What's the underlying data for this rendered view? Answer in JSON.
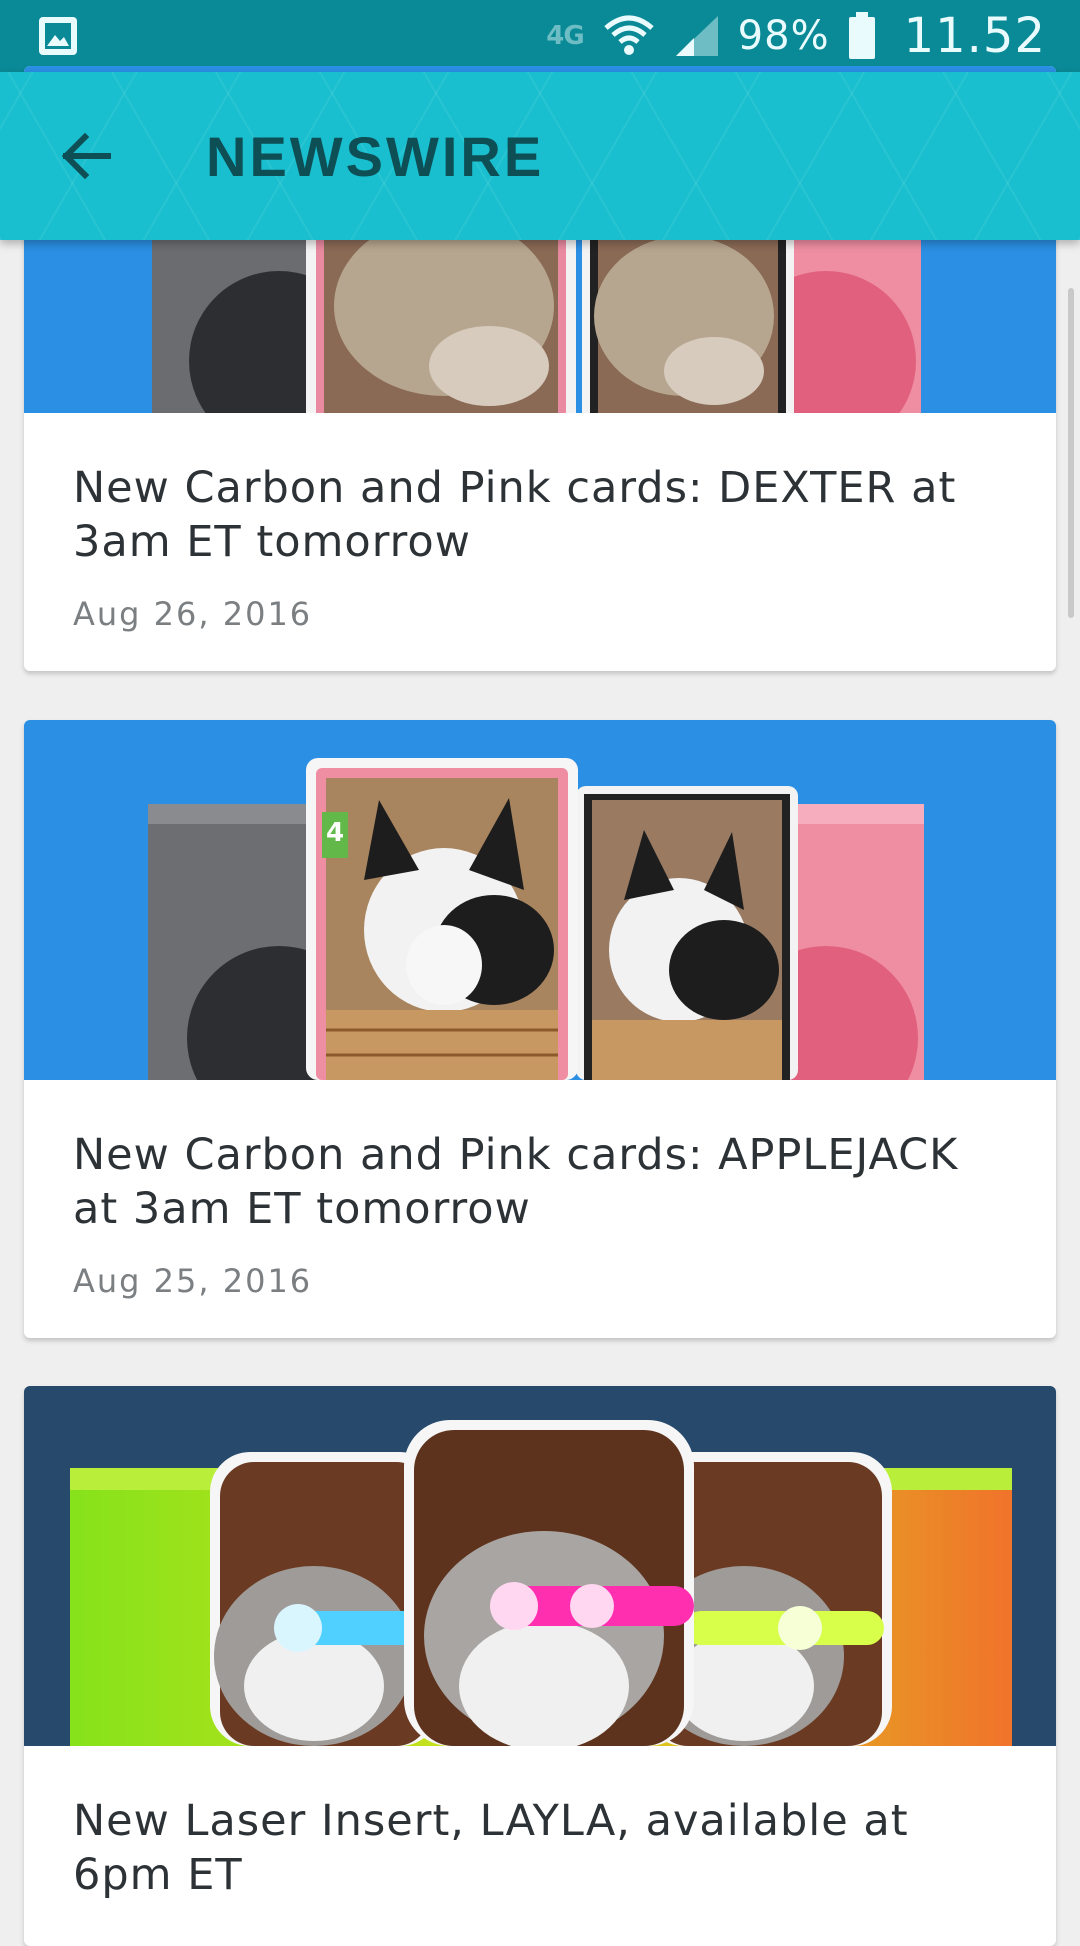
{
  "status_bar": {
    "network": "4G",
    "battery": "98%",
    "time": "11.52",
    "icons": [
      "gallery-icon",
      "network-4g-icon",
      "wifi-icon",
      "signal-icon",
      "battery-icon"
    ]
  },
  "app_bar": {
    "title": "NEWSWIRE",
    "back_icon": "arrow-back-icon"
  },
  "colors": {
    "status_bar": "#0a8a96",
    "app_bar": "#19bfcf",
    "title": "#0e4f55",
    "card_bg_blue": "#2b8fe4",
    "card_bg_navy": "#27496b",
    "background": "#efefef"
  },
  "news": [
    {
      "title": "New Carbon and Pink cards: DEXTER at 3am ET tomorrow",
      "date": "Aug 26, 2016"
    },
    {
      "title": "New Carbon and Pink cards: APPLEJACK at 3am ET tomorrow",
      "date": "Aug 25, 2016",
      "card_badge": "4"
    },
    {
      "title": "New Laser Insert, LAYLA, available at 6pm ET"
    }
  ]
}
